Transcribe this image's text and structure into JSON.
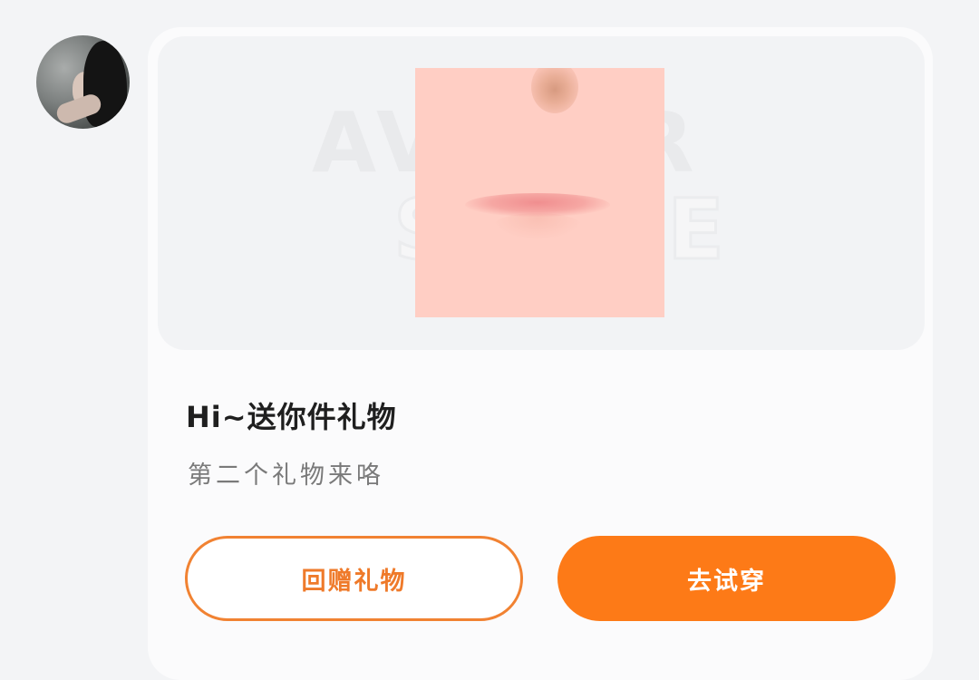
{
  "message": {
    "title": "Hi~送你件礼物",
    "subtitle": "第二个礼物来咯"
  },
  "watermark": {
    "line1": "AVATAR",
    "line2": "STORE"
  },
  "buttons": {
    "return_gift": "回赠礼物",
    "try_on": "去试穿"
  },
  "colors": {
    "accent": "#fd7a17",
    "outline": "#f18232",
    "page_bg": "#f3f4f6",
    "card_bg": "#fbfbfc",
    "item_bg": "#ffcec4"
  },
  "icons": {
    "avatar": "user-avatar-photo",
    "item": "lip-makeup-thumbnail"
  }
}
